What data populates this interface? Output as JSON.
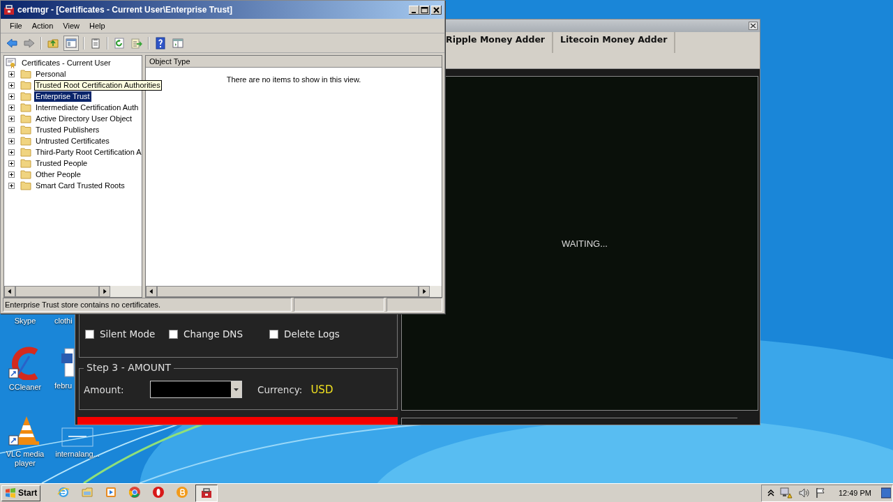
{
  "desktop_icons": [
    {
      "label": "Skype",
      "kind": "hidden"
    },
    {
      "label": "clothi",
      "kind": "hidden"
    },
    {
      "label": "CCleaner",
      "kind": "ccleaner"
    },
    {
      "label": "febru",
      "kind": "document"
    },
    {
      "label": "VLC media player",
      "kind": "vlc"
    },
    {
      "label": "internalang...",
      "kind": "blank"
    }
  ],
  "money_window": {
    "tabs": [
      {
        "label": "Ripple Money Adder",
        "selected": false
      },
      {
        "label": "Litecoin Money Adder",
        "selected": false
      }
    ],
    "options": [
      {
        "label": "Silent Mode",
        "checked": false
      },
      {
        "label": "Change DNS",
        "checked": false
      },
      {
        "label": "Delete Logs",
        "checked": false
      }
    ],
    "amount_group": {
      "title": "Step 3 - AMOUNT",
      "amount_label": "Amount:",
      "currency_label": "Currency:",
      "currency": "USD"
    },
    "output": "WAITING..."
  },
  "certmgr": {
    "title": "certmgr - [Certificates - Current User\\Enterprise Trust]",
    "menu": [
      "File",
      "Action",
      "View",
      "Help"
    ],
    "tree": {
      "label": "Certificates - Current User",
      "children": [
        {
          "label": "Personal",
          "selected": false,
          "tooltip": false
        },
        {
          "label": "Trusted Root Certification Authorities",
          "selected": false,
          "tooltip": true
        },
        {
          "label": "Enterprise Trust",
          "selected": true,
          "tooltip": false
        },
        {
          "label": "Intermediate Certification Auth",
          "selected": false,
          "tooltip": false
        },
        {
          "label": "Active Directory User Object",
          "selected": false,
          "tooltip": false
        },
        {
          "label": "Trusted Publishers",
          "selected": false,
          "tooltip": false
        },
        {
          "label": "Untrusted Certificates",
          "selected": false,
          "tooltip": false
        },
        {
          "label": "Third-Party Root Certification A",
          "selected": false,
          "tooltip": false
        },
        {
          "label": "Trusted People",
          "selected": false,
          "tooltip": false
        },
        {
          "label": "Other People",
          "selected": false,
          "tooltip": false
        },
        {
          "label": "Smart Card Trusted Roots",
          "selected": false,
          "tooltip": false
        }
      ]
    },
    "list": {
      "columns": [
        "Object Type"
      ],
      "empty_message": "There are no items to show in this view."
    },
    "status_bar": [
      "Enterprise Trust store contains no certificates."
    ]
  },
  "taskbar": {
    "start": "Start",
    "clock": "12:49 PM"
  }
}
